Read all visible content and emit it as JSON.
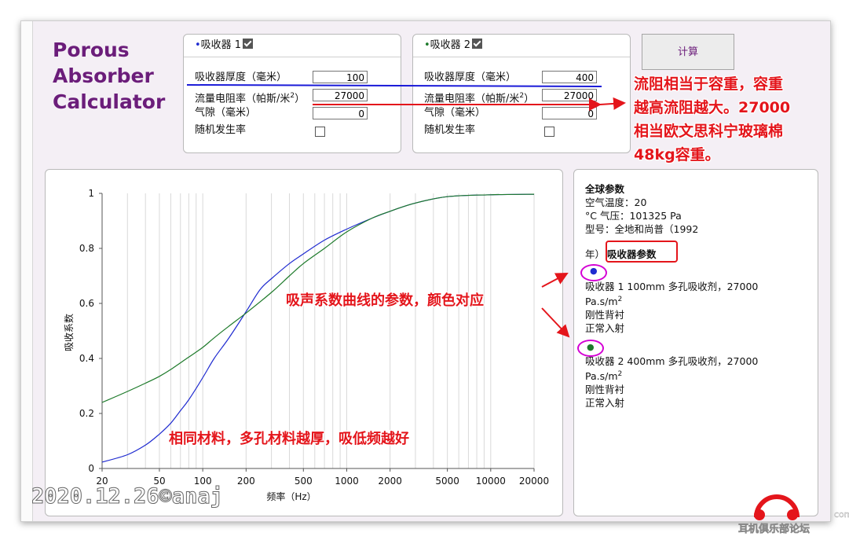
{
  "app": {
    "logo_lines": [
      "Porous",
      "Absorber",
      "Calculator"
    ],
    "calc_button": "计算"
  },
  "absorber1": {
    "title": "吸收器 1",
    "dot_color": "#1f2bd0",
    "enabled": true,
    "fields": [
      {
        "label": "吸收器厚度（毫米）",
        "value": "100"
      },
      {
        "label": "流量电阻率（帕斯/米",
        "sup": "2",
        "label_end": "）",
        "value": "27000"
      },
      {
        "label": "气隙（毫米）",
        "value": "0"
      },
      {
        "label": "随机发生率",
        "checkbox": false
      }
    ]
  },
  "absorber2": {
    "title": "吸收器 2",
    "dot_color": "#1d7a2a",
    "enabled": true,
    "fields": [
      {
        "label": "吸收器厚度（毫米）",
        "value": "400"
      },
      {
        "label": "流量电阻率（帕斯/米",
        "sup": "2",
        "label_end": "）",
        "value": "27000"
      },
      {
        "label": "气隙（毫米）",
        "value": "0"
      },
      {
        "label": "随机发生率",
        "checkbox": false
      }
    ]
  },
  "info": {
    "global_title": "全球参数",
    "air_temp": "空气温度：20",
    "pressure": "°C 气压：101325 Pa",
    "model": "型号：全地和尚普（1992",
    "year_prefix": "年）",
    "absorber_params": "吸收器参数",
    "abs1": {
      "line1": "吸收器 1 100mm 多孔吸收剂，27000",
      "unit": "Pa.s/m",
      "sup": "2",
      "backing": "刚性背衬",
      "incidence": "正常入射"
    },
    "abs2": {
      "line1": "吸收器 2 400mm 多孔吸收剂，27000",
      "unit": "Pa.s/m",
      "sup": "2",
      "backing": "刚性背衬",
      "incidence": "正常入射"
    }
  },
  "annotations": {
    "flow_note": [
      "流阻相当于容重，容重",
      "越高流阻越大。27000",
      "相当欧文思科宁玻璃棉",
      "48kg容重。"
    ],
    "curve_note": "吸声系数曲线的参数，颜色对应",
    "thickness_note": "相同材料，多孔材料越厚，吸低频越好",
    "color": "#e4151b"
  },
  "watermark": {
    "text": "2020.12.26©anaj",
    "forum": "耳机俱乐部论坛",
    "forum_domain": "com"
  },
  "chart_data": {
    "type": "line",
    "xlabel": "频率（Hz）",
    "ylabel": "吸收系数",
    "xscale": "log",
    "xlim": [
      20,
      20000
    ],
    "ylim": [
      0,
      1
    ],
    "x_ticks": [
      20,
      50,
      100,
      200,
      500,
      1000,
      2000,
      5000,
      10000,
      20000
    ],
    "x_tick_labels": [
      "20",
      "50",
      "100",
      "200",
      "500",
      "1000",
      "2000",
      "5000",
      "10000",
      "20000"
    ],
    "y_ticks": [
      0,
      0.2,
      0.4,
      0.6,
      0.8,
      1
    ],
    "y_tick_labels": [
      "0",
      "0.2",
      "0.4",
      "0.6",
      "0.8",
      "1"
    ],
    "grid": "vertical",
    "series": [
      {
        "color": "#1f2bd0",
        "x": [
          20,
          30,
          40,
          50,
          60,
          70,
          80,
          100,
          120,
          150,
          200,
          250,
          300,
          400,
          500,
          700,
          1000,
          1500,
          2000,
          3000,
          5000,
          10000,
          20000
        ],
        "y": [
          0.023,
          0.05,
          0.085,
          0.125,
          0.165,
          0.21,
          0.25,
          0.33,
          0.4,
          0.47,
          0.57,
          0.65,
          0.69,
          0.745,
          0.78,
          0.83,
          0.87,
          0.91,
          0.935,
          0.965,
          0.988,
          0.995,
          0.997
        ]
      },
      {
        "color": "#1d7a2a",
        "x": [
          20,
          30,
          40,
          50,
          60,
          80,
          100,
          120,
          150,
          200,
          300,
          400,
          500,
          700,
          1000,
          1500,
          2000,
          3000,
          5000,
          10000,
          20000
        ],
        "y": [
          0.24,
          0.28,
          0.31,
          0.335,
          0.36,
          0.405,
          0.44,
          0.475,
          0.515,
          0.565,
          0.64,
          0.7,
          0.745,
          0.8,
          0.86,
          0.91,
          0.935,
          0.965,
          0.988,
          0.995,
          0.997
        ]
      }
    ]
  }
}
